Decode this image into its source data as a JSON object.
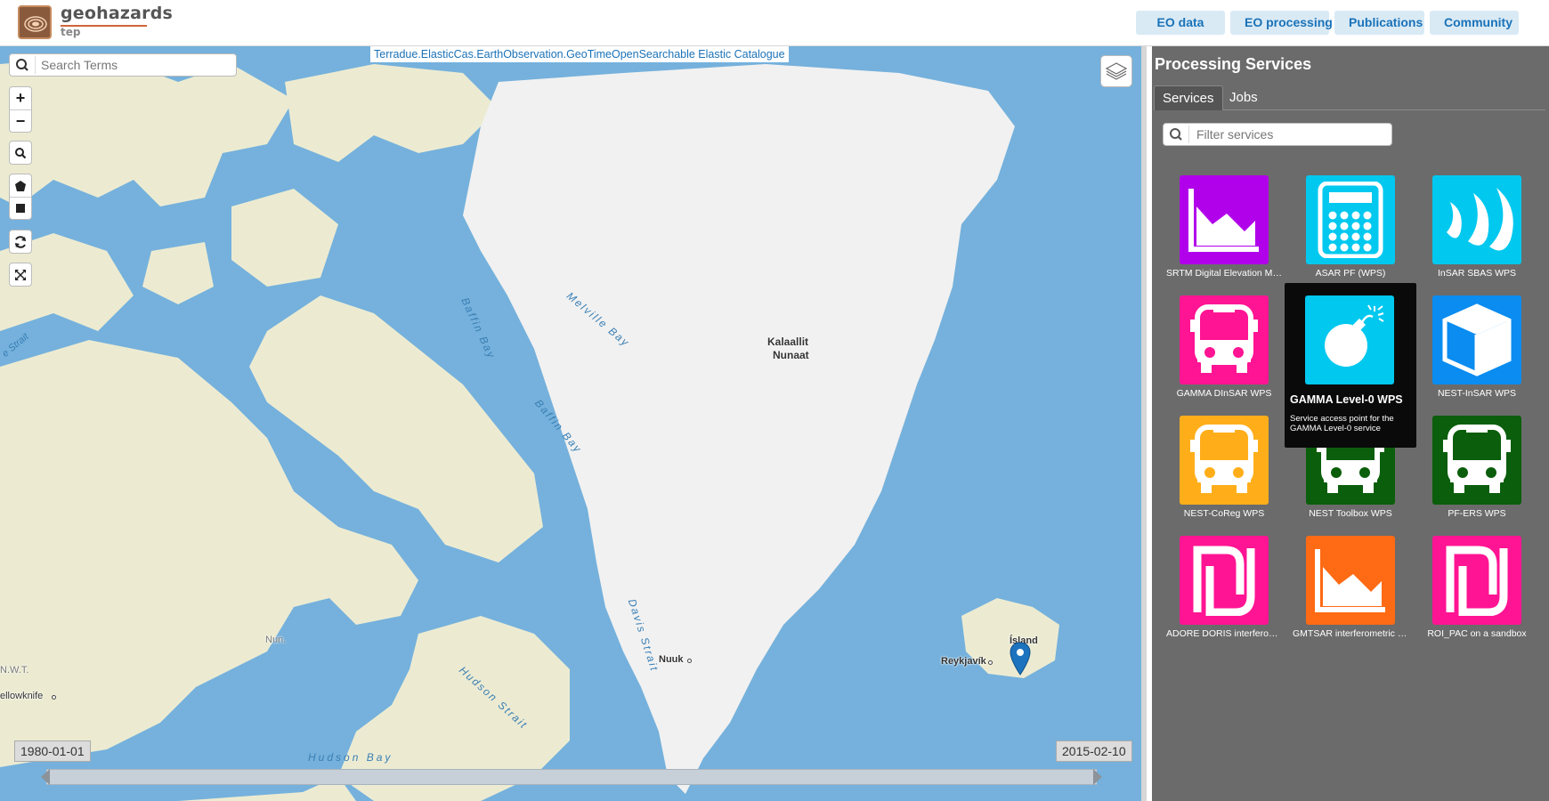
{
  "header": {
    "logo_name": "geohazards",
    "logo_sub": "tep",
    "nav": [
      "EO data",
      "EO processing",
      "Publications",
      "Community"
    ]
  },
  "map": {
    "catalogue_label": "Terradue.ElasticCas.EarthObservation.GeoTimeOpenSearchable Elastic Catalogue",
    "search_placeholder": "Search Terms",
    "zoom_in": "+",
    "zoom_out": "−",
    "start_date": "1980-01-01",
    "end_date": "2015-02-10",
    "places": {
      "kalaallit": "Kalaallit",
      "nunaat": "Nunaat",
      "nuuk": "Nuuk",
      "island": "Ísland",
      "reykjavik": "Reykjavík",
      "yellowknife": "ellowknife",
      "nun": "Nun.",
      "nwt": "N.W.T.",
      "strait": "e Strait"
    },
    "seas": {
      "baffin1": "Baffin Bay",
      "baffin2": "Baffin Bay",
      "melville": "Melville Bay",
      "davis": "Davis Strait",
      "hudson_strait": "Hudson Strait",
      "hudson_bay": "Hudson Bay"
    }
  },
  "panel": {
    "title": "Processing Services",
    "tabs": [
      "Services",
      "Jobs"
    ],
    "filter_placeholder": "Filter services",
    "services": [
      {
        "label": "SRTM Digital Elevation Mo...",
        "color": "#b100ea",
        "icon": "area-chart-icon"
      },
      {
        "label": "ASAR PF (WPS)",
        "color": "#00c8ef",
        "icon": "calculator-icon"
      },
      {
        "label": "InSAR SBAS WPS",
        "color": "#00c8ef",
        "icon": "waves-icon"
      },
      {
        "label": "GAMMA DInSAR WPS",
        "color": "#ff1493",
        "icon": "bus-icon"
      },
      {
        "label": "NEST-InSAR WPS",
        "color": "#0a8cf0",
        "icon": "cube-icon"
      },
      {
        "label": "NEST-CoReg WPS",
        "color": "#ffae1a",
        "icon": "bus-icon"
      },
      {
        "label": "NEST Toolbox WPS",
        "color": "#0b5e0b",
        "icon": "bus-icon"
      },
      {
        "label": "PF-ERS WPS",
        "color": "#0b5e0b",
        "icon": "bus-icon"
      },
      {
        "label": "ADORE DORIS interferom...",
        "color": "#ff1493",
        "icon": "shekel-icon"
      },
      {
        "label": "GMTSAR interferometric p...",
        "color": "#ff6a14",
        "icon": "area-chart-icon"
      },
      {
        "label": "ROI_PAC on a sandbox",
        "color": "#ff1493",
        "icon": "shekel-icon"
      }
    ],
    "tooltip": {
      "title": "GAMMA Level-0 WPS",
      "description": "Service access point for the GAMMA Level-0 service",
      "color": "#00c8ef",
      "icon": "bomb-icon"
    }
  }
}
